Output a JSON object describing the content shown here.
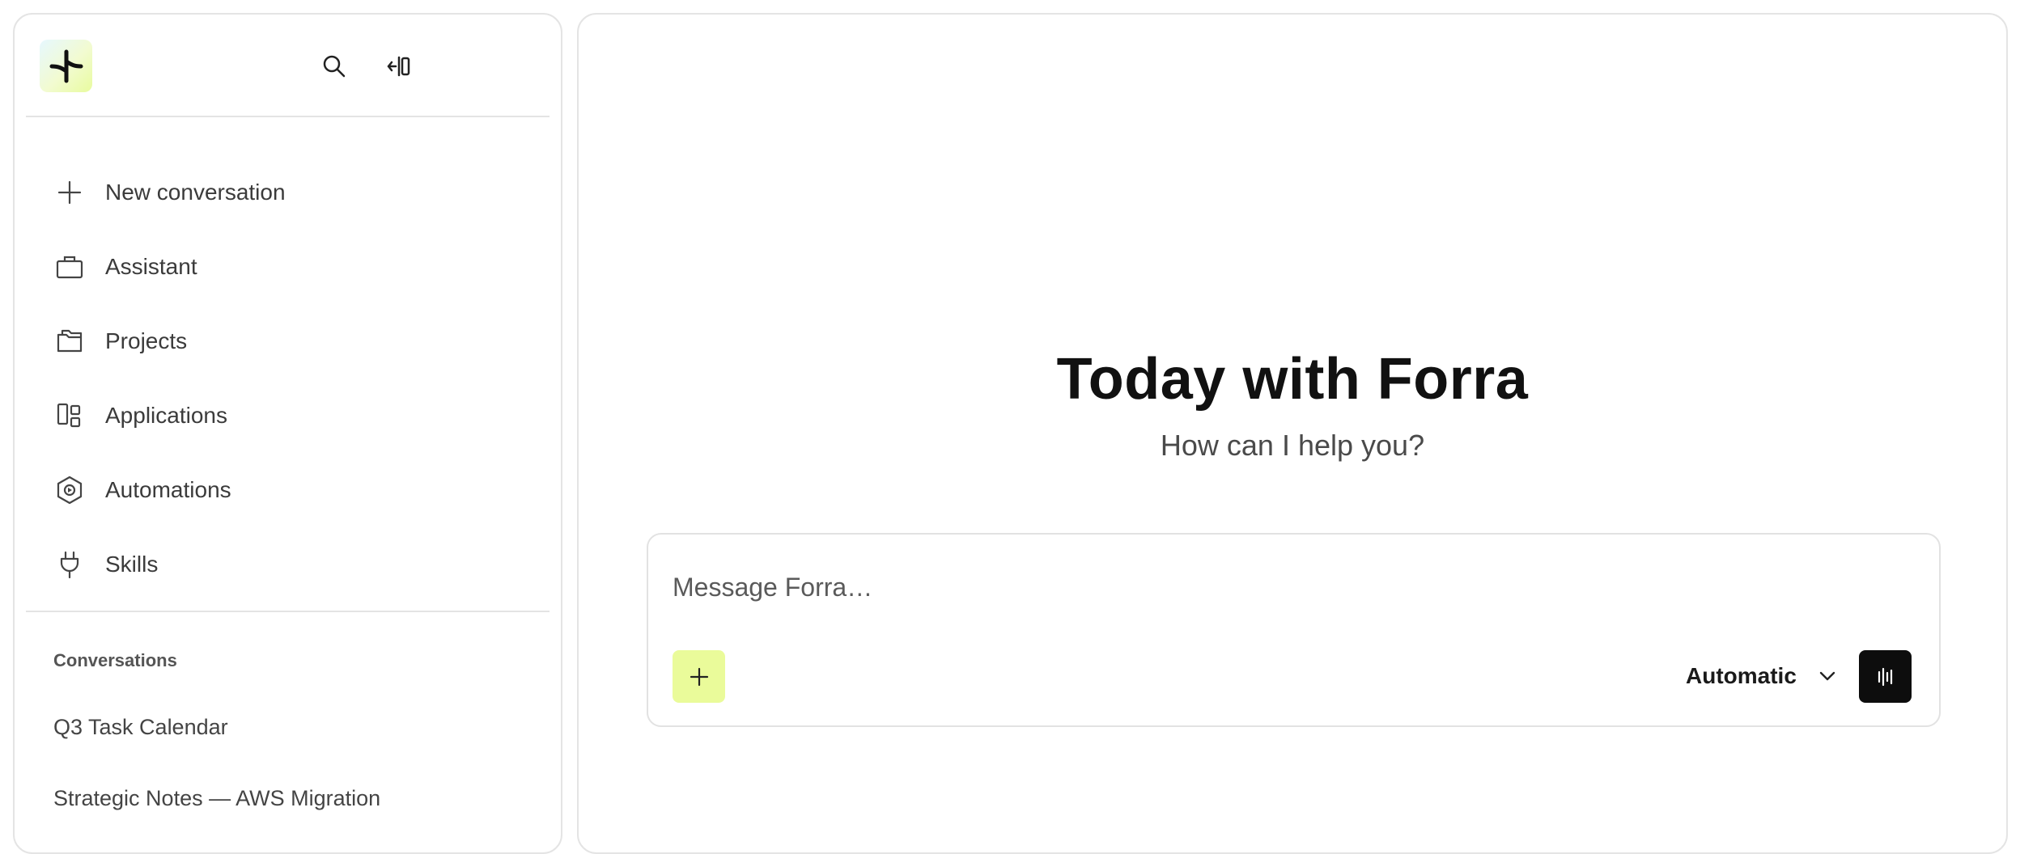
{
  "sidebar": {
    "logo": "forra-logo",
    "search_icon": "search-icon",
    "collapse_icon": "collapse-sidebar-icon",
    "items": [
      {
        "label": "New conversation",
        "icon": "plus-icon"
      },
      {
        "label": "Assistant",
        "icon": "briefcase-icon"
      },
      {
        "label": "Projects",
        "icon": "folders-icon"
      },
      {
        "label": "Applications",
        "icon": "apps-grid-icon"
      },
      {
        "label": "Automations",
        "icon": "automation-hexagon-icon"
      },
      {
        "label": "Skills",
        "icon": "plug-icon"
      }
    ],
    "conversations_title": "Conversations",
    "conversations": [
      {
        "label": "Q3 Task Calendar"
      },
      {
        "label": "Strategic Notes — AWS Migration"
      }
    ]
  },
  "main": {
    "title": "Today with Forra",
    "subtitle": "How can I help you?",
    "composer": {
      "placeholder": "Message Forra…",
      "attach_icon": "plus-icon",
      "model_label": "Automatic",
      "model_icon": "chevron-down-icon",
      "voice_icon": "waveform-icon"
    }
  },
  "colors": {
    "accent": "#eafb9a",
    "voice_button": "#0d0d0d",
    "border": "#e4e4e4"
  }
}
